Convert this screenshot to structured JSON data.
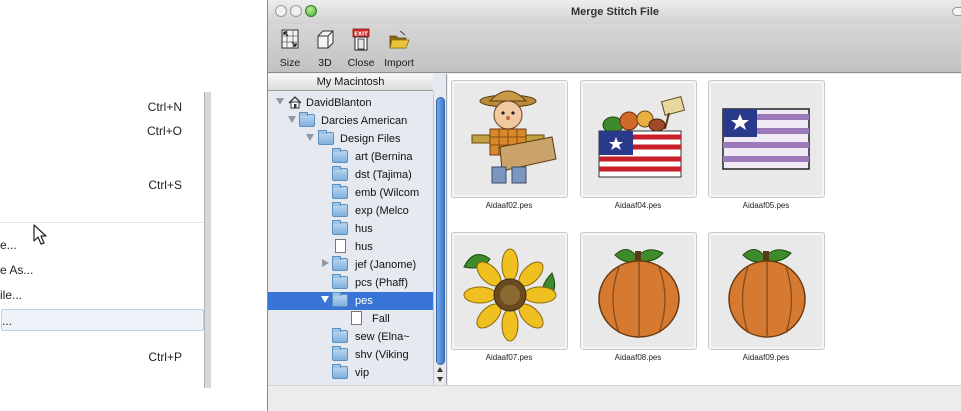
{
  "file_menu": {
    "items": [
      {
        "label": "",
        "shortcut": "Ctrl+N"
      },
      {
        "label": "",
        "shortcut": "Ctrl+O"
      },
      {
        "label": "",
        "shortcut": "Ctrl+S"
      },
      {
        "label": "e...",
        "shortcut": ""
      },
      {
        "label": "e As...",
        "shortcut": ""
      },
      {
        "label": "ile...",
        "shortcut": ""
      },
      {
        "label": "...",
        "shortcut": ""
      },
      {
        "label": "",
        "shortcut": "Ctrl+P"
      }
    ]
  },
  "window": {
    "title": "Merge Stitch File"
  },
  "toolbar": {
    "size_label": "Size",
    "threed_label": "3D",
    "close_label": "Close",
    "import_label": "Import",
    "exit_badge": "EXIT"
  },
  "sidebar": {
    "header": "My Macintosh",
    "tree": [
      {
        "label": "DavidBlanton",
        "icon": "home-icon",
        "disclosure": "open"
      },
      {
        "label": "Darcies American",
        "icon": "folder-icon",
        "disclosure": "open"
      },
      {
        "label": "Design Files",
        "icon": "folder-icon",
        "disclosure": "open"
      },
      {
        "label": "art (Bernina",
        "icon": "folder-icon",
        "disclosure": "none"
      },
      {
        "label": "dst (Tajima)",
        "icon": "folder-icon",
        "disclosure": "none"
      },
      {
        "label": "emb (Wilcom",
        "icon": "folder-icon",
        "disclosure": "none"
      },
      {
        "label": "exp (Melco",
        "icon": "folder-icon",
        "disclosure": "none"
      },
      {
        "label": "hus",
        "icon": "folder-icon",
        "disclosure": "none"
      },
      {
        "label": "hus",
        "icon": "document-icon",
        "disclosure": "none"
      },
      {
        "label": "jef (Janome)",
        "icon": "folder-icon",
        "disclosure": "closed"
      },
      {
        "label": "pcs (Phaff)",
        "icon": "folder-icon",
        "disclosure": "none"
      },
      {
        "label": "pes",
        "icon": "folder-icon",
        "disclosure": "open",
        "selected": true
      },
      {
        "label": "Fall",
        "icon": "document-icon",
        "disclosure": "none"
      },
      {
        "label": "sew (Elna~",
        "icon": "folder-icon",
        "disclosure": "none"
      },
      {
        "label": "shv (Viking",
        "icon": "folder-icon",
        "disclosure": "none"
      },
      {
        "label": "vip",
        "icon": "folder-icon",
        "disclosure": "none"
      }
    ]
  },
  "grid": {
    "files": [
      {
        "name": "Aidaaf02.pes",
        "design": "scarecrow",
        "checked": true
      },
      {
        "name": "Aidaaf04.pes",
        "design": "flag-basket"
      },
      {
        "name": "Aidaaf05.pes",
        "design": "flag"
      },
      {
        "name": "Aidaaf07.pes",
        "design": "sunflower"
      },
      {
        "name": "Aidaaf08.pes",
        "design": "pumpkin"
      },
      {
        "name": "Aidaaf09.pes",
        "design": "pumpkin"
      }
    ]
  },
  "colors": {
    "selection": "#3875d7",
    "sidebar_bg": "#e6eaf0",
    "check_badge": "#2fa84a"
  }
}
